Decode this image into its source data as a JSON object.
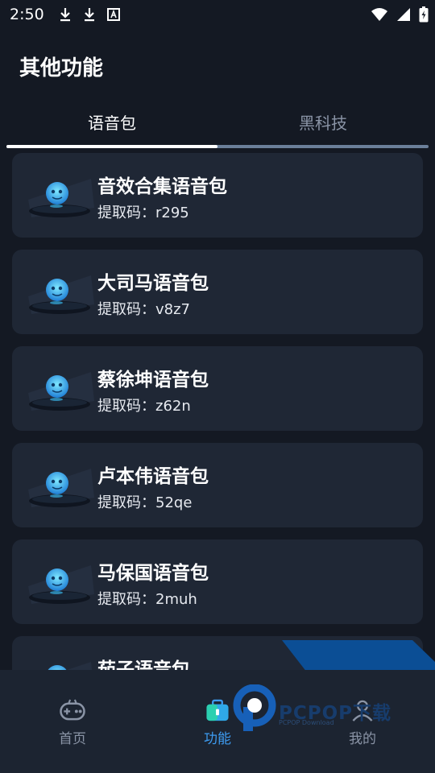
{
  "status_bar": {
    "time": "2:50",
    "icons": [
      "download-icon",
      "download-icon",
      "font-icon",
      "wifi-icon",
      "signal-icon",
      "battery-icon"
    ]
  },
  "page": {
    "title": "其他功能"
  },
  "tabs": [
    {
      "label": "语音包",
      "active": true
    },
    {
      "label": "黑科技",
      "active": false
    }
  ],
  "cards": [
    {
      "title": "音效合集语音包",
      "code": "提取码：r295"
    },
    {
      "title": "大司马语音包",
      "code": "提取码：v8z7"
    },
    {
      "title": "蔡徐坤语音包",
      "code": "提取码：z62n"
    },
    {
      "title": "卢本伟语音包",
      "code": "提取码：52qe"
    },
    {
      "title": "马保国语音包",
      "code": "提取码：2muh"
    },
    {
      "title": "茄子语音包",
      "code": ""
    }
  ],
  "bottom_nav": [
    {
      "label": "首页",
      "icon": "gamepad-icon",
      "active": false
    },
    {
      "label": "功能",
      "icon": "toolbox-icon",
      "active": true
    },
    {
      "label": "我的",
      "icon": "person-icon",
      "active": false
    }
  ],
  "watermark": {
    "brand": "PCPOP下载",
    "sub": "PCPOP Download"
  },
  "colors": {
    "background": "#141923",
    "card": "#1f2735",
    "nav_active": "#3d9bf0",
    "nav_inactive": "#8a94a6",
    "tab_track": "#6b7f9a"
  }
}
